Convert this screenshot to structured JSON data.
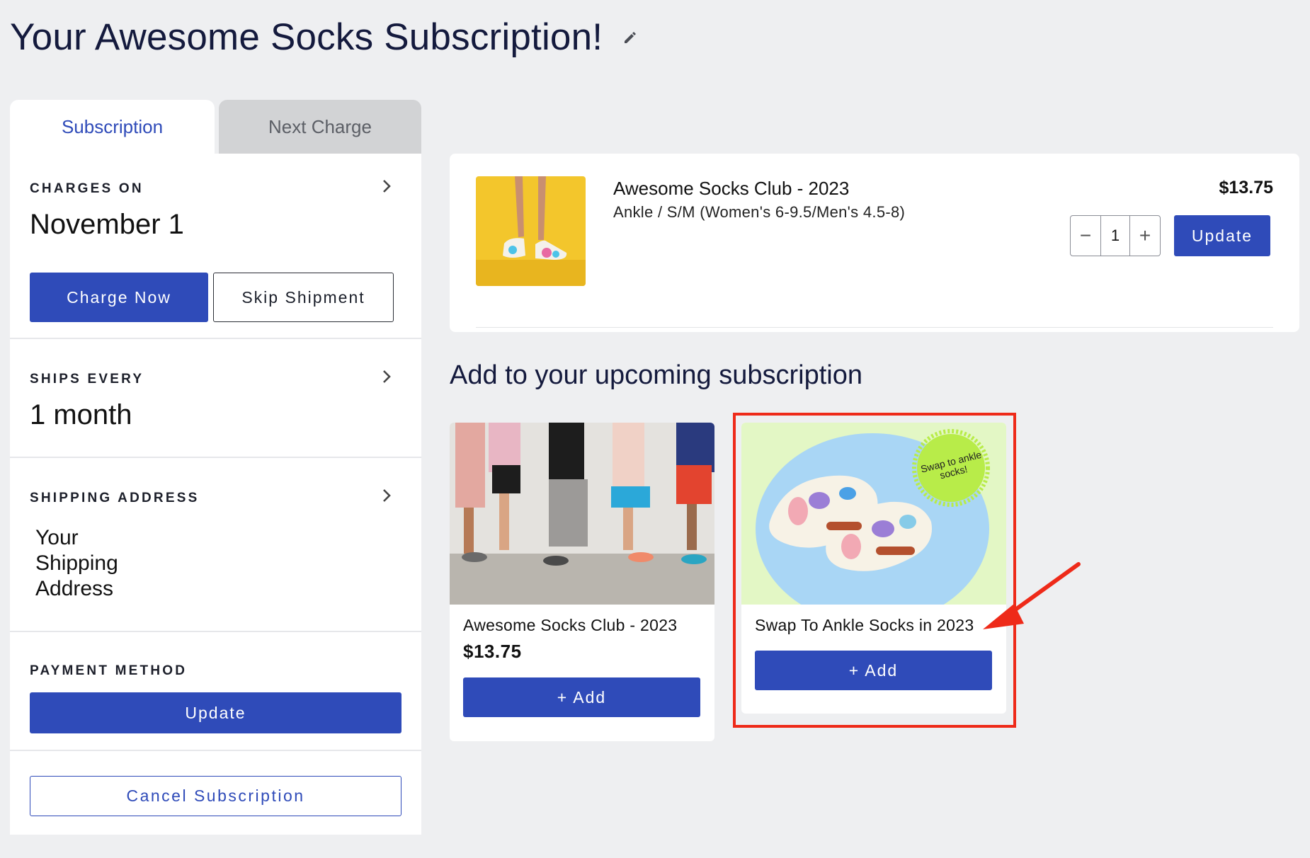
{
  "page": {
    "title": "Your Awesome Socks Subscription!"
  },
  "tabs": [
    {
      "label": "Subscription",
      "active": true
    },
    {
      "label": "Next Charge",
      "active": false
    }
  ],
  "left_panel": {
    "charges_on": {
      "label": "CHARGES ON",
      "value": "November 1",
      "charge_now_label": "Charge Now",
      "skip_label": "Skip Shipment"
    },
    "ships_every": {
      "label": "SHIPS EVERY",
      "value": "1 month"
    },
    "shipping_address": {
      "label": "SHIPPING ADDRESS",
      "lines": [
        "Your",
        "Shipping",
        "Address"
      ]
    },
    "payment_method": {
      "label": "PAYMENT METHOD",
      "update_label": "Update"
    },
    "cancel_label": "Cancel Subscription"
  },
  "product": {
    "name": "Awesome Socks Club - 2023",
    "variant": "Ankle / S/M (Women's 6-9.5/Men's 4.5-8)",
    "price": "$13.75",
    "quantity": "1",
    "decrement_symbol": "−",
    "increment_symbol": "+",
    "update_label": "Update"
  },
  "upsell": {
    "title": "Add to your upcoming subscription",
    "items": [
      {
        "name": "Awesome Socks Club - 2023",
        "price": "$13.75",
        "add_label": "+ Add"
      },
      {
        "name": "Swap To Ankle Socks in 2023",
        "badge_text": "Swap to ankle socks!",
        "add_label": "+ Add"
      }
    ]
  },
  "colors": {
    "primary": "#2f4bb9",
    "background": "#eeeff1",
    "highlight": "#ee2a19",
    "tab_inactive": "#d2d3d5"
  },
  "icons": [
    "pencil-icon",
    "chevron-right-icon",
    "minus-icon",
    "plus-icon",
    "arrow-annotation-icon"
  ]
}
